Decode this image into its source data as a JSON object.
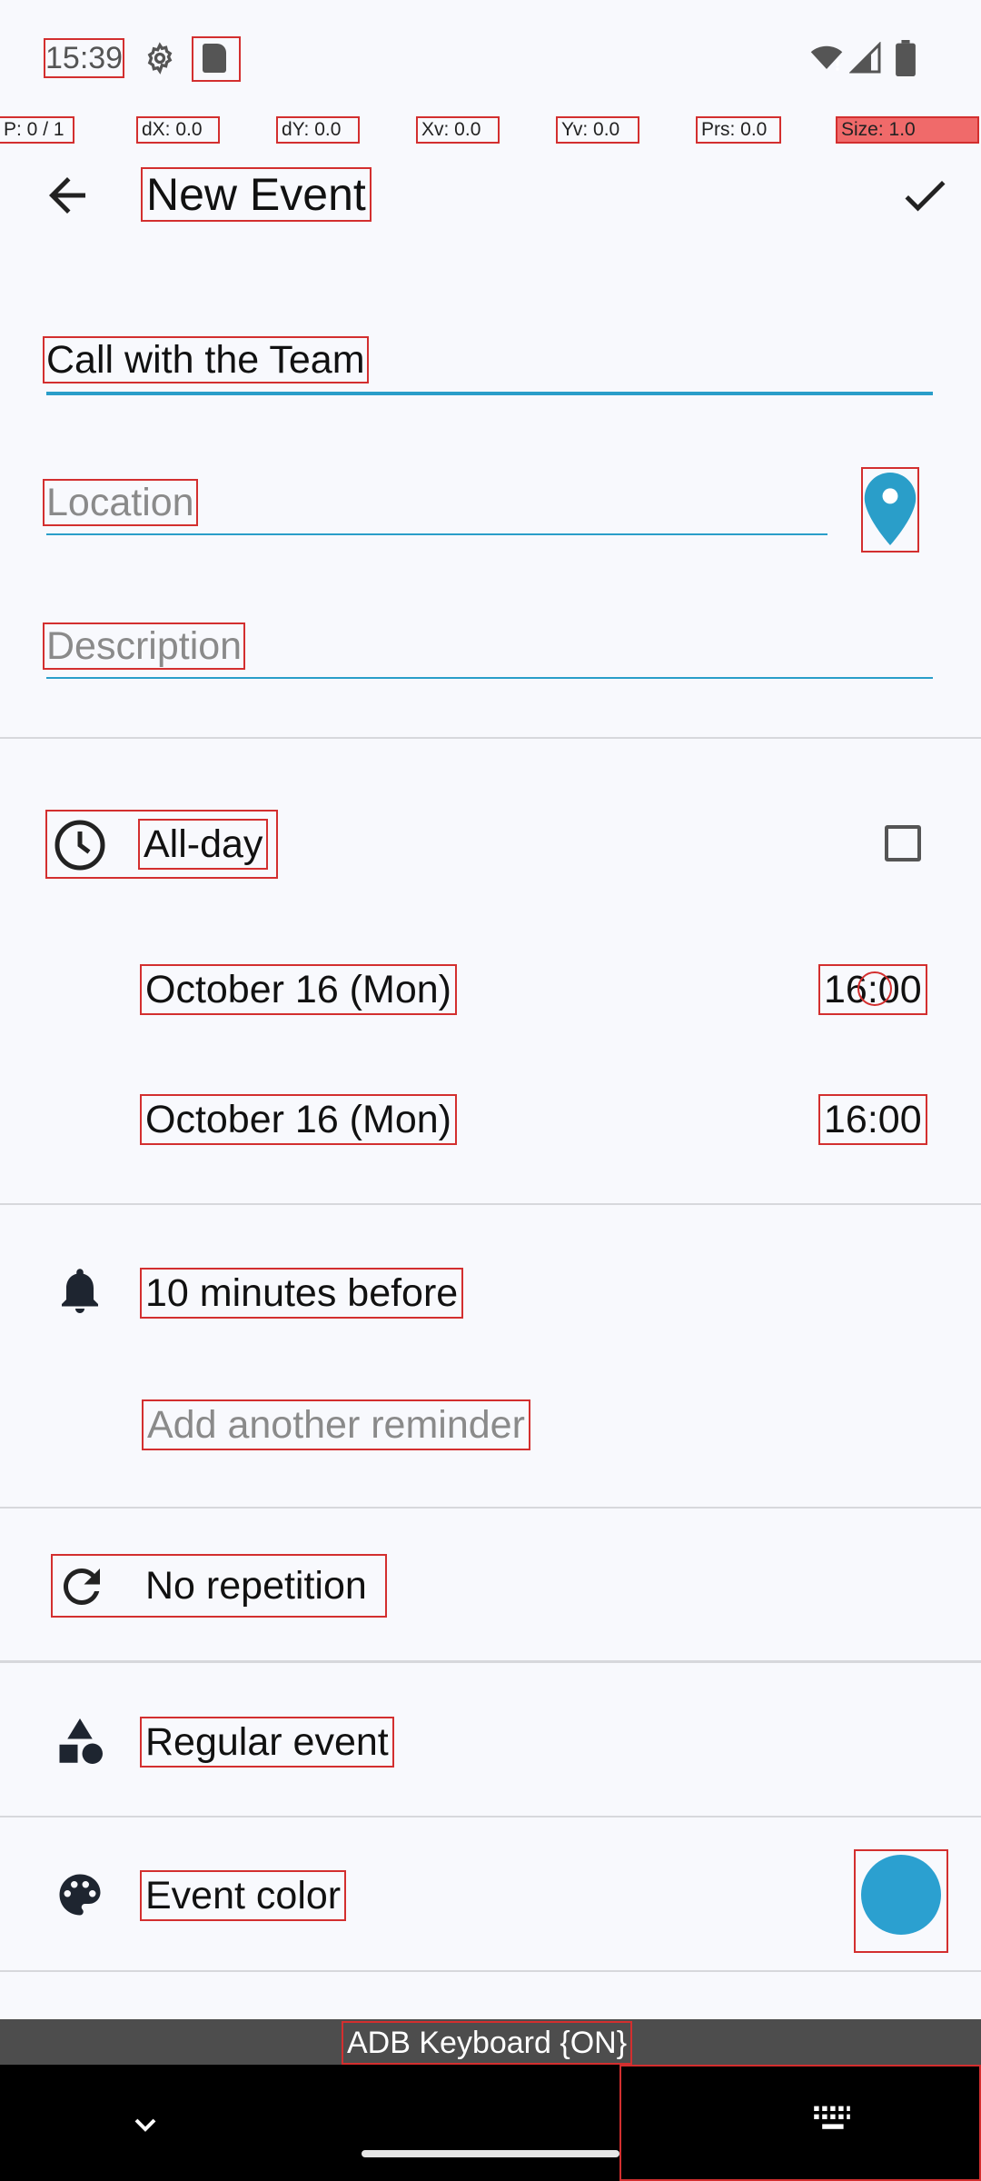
{
  "status_bar": {
    "time": "15:39"
  },
  "debug_overlay": {
    "pointer": "P: 0 / 1",
    "dx": "dX: 0.0",
    "dy": "dY: 0.0",
    "xv": "Xv: 0.0",
    "yv": "Yv: 0.0",
    "prs": "Prs: 0.0",
    "size": "Size: 1.0"
  },
  "app_bar": {
    "title": "New Event"
  },
  "form": {
    "title_value": "Call with the Team",
    "location_placeholder": "Location",
    "description_placeholder": "Description"
  },
  "schedule": {
    "all_day_label": "All-day",
    "all_day_checked": false,
    "start_date": "October 16 (Mon)",
    "start_time": "16:00",
    "end_date": "October 16 (Mon)",
    "end_time": "16:00"
  },
  "reminders": {
    "reminder_1": "10 minutes before",
    "add_reminder": "Add another reminder"
  },
  "repetition": {
    "label": "No repetition"
  },
  "event_type": {
    "label": "Regular event"
  },
  "event_color": {
    "label": "Event color",
    "color": "#2ba0d0"
  },
  "keyboard": {
    "label": "ADB Keyboard {ON}"
  },
  "icons": {
    "back": "arrow-back-icon",
    "save": "check-icon",
    "location": "map-pin-icon",
    "all_day": "clock-icon",
    "reminder": "bell-icon",
    "repeat": "repeat-icon",
    "type": "shapes-icon",
    "color": "palette-icon"
  },
  "colors": {
    "accent": "#2a9ec9",
    "background": "#f8f9fd"
  }
}
